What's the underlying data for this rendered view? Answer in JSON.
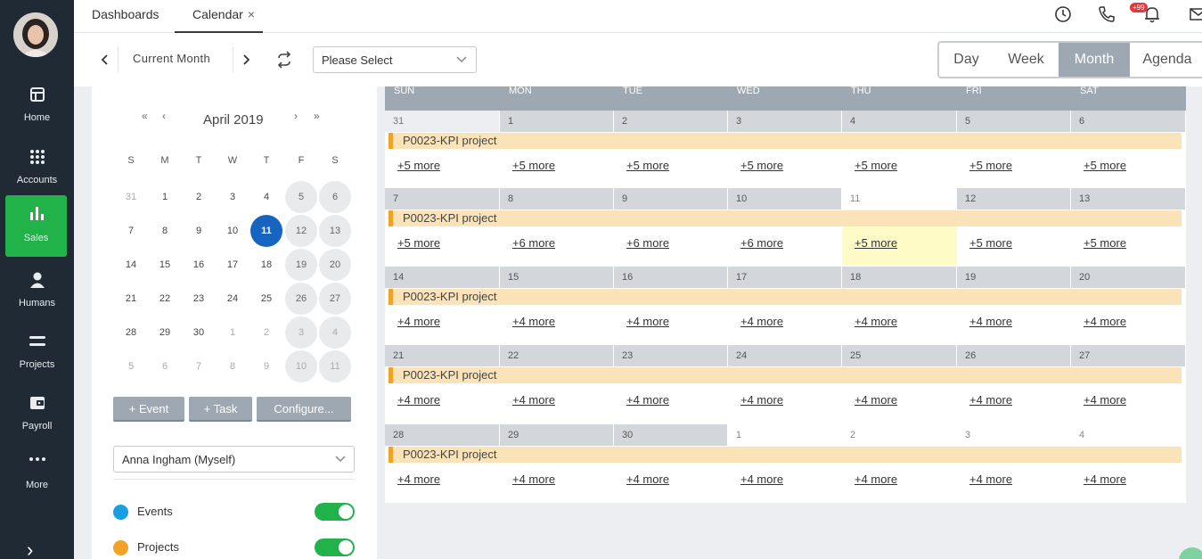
{
  "sidebar": {
    "items": [
      {
        "label": "Home",
        "icon": "home-icon"
      },
      {
        "label": "Accounts",
        "icon": "grid-icon"
      },
      {
        "label": "Sales",
        "icon": "bar-chart-icon"
      },
      {
        "label": "Humans",
        "icon": "person-icon"
      },
      {
        "label": "Projects",
        "icon": "list-icon"
      },
      {
        "label": "Payroll",
        "icon": "wallet-icon"
      },
      {
        "label": "More",
        "icon": "dots-icon"
      }
    ],
    "active_item": "Sales",
    "expand_glyph": "›"
  },
  "tabs": {
    "dashboards": "Dashboards",
    "calendar": "Calendar",
    "close_glyph": "×"
  },
  "notifications": {
    "badge": "+99"
  },
  "toolbar": {
    "current_month": "Current Month",
    "prev_glyph": "‹",
    "next_glyph": "›",
    "select_placeholder": "Please Select",
    "views": [
      "Day",
      "Week",
      "Month",
      "Agenda"
    ],
    "active_view": "Month"
  },
  "mini_calendar": {
    "title": "April 2019",
    "prev_year": "«",
    "prev_month": "‹",
    "next_month": "›",
    "next_year": "»",
    "weekday_labels": [
      "S",
      "M",
      "T",
      "W",
      "T",
      "F",
      "S"
    ],
    "weeks": [
      [
        "31",
        "1",
        "2",
        "3",
        "4",
        "5",
        "6"
      ],
      [
        "7",
        "8",
        "9",
        "10",
        "11",
        "12",
        "13"
      ],
      [
        "14",
        "15",
        "16",
        "17",
        "18",
        "19",
        "20"
      ],
      [
        "21",
        "22",
        "23",
        "24",
        "25",
        "26",
        "27"
      ],
      [
        "28",
        "29",
        "30",
        "1",
        "2",
        "3",
        "4"
      ],
      [
        "5",
        "6",
        "7",
        "8",
        "9",
        "10",
        "11"
      ]
    ],
    "today": "11"
  },
  "actions": {
    "add_event": "+ Event",
    "add_task": "+ Task",
    "configure": "Configure..."
  },
  "user_select": {
    "value": "Anna Ingham (Myself)"
  },
  "legend": [
    {
      "label": "Events",
      "color": "#1a9ee2",
      "enabled": true
    },
    {
      "label": "Projects",
      "color": "#f0a229",
      "enabled": true
    }
  ],
  "calendar": {
    "weekday_headers": [
      "SUN",
      "MON",
      "TUE",
      "WED",
      "THU",
      "FRI",
      "SAT"
    ],
    "weeks": [
      {
        "days": [
          "31",
          "1",
          "2",
          "3",
          "4",
          "5",
          "6"
        ],
        "more": [
          "+5 more",
          "+5 more",
          "+5 more",
          "+5 more",
          "+5 more",
          "+5 more",
          "+5 more"
        ]
      },
      {
        "days": [
          "7",
          "8",
          "9",
          "10",
          "11",
          "12",
          "13"
        ],
        "more": [
          "+5 more",
          "+6 more",
          "+6 more",
          "+6 more",
          "+5 more",
          "+5 more",
          "+5 more"
        ]
      },
      {
        "days": [
          "14",
          "15",
          "16",
          "17",
          "18",
          "19",
          "20"
        ],
        "more": [
          "+4 more",
          "+4 more",
          "+4 more",
          "+4 more",
          "+4 more",
          "+4 more",
          "+4 more"
        ]
      },
      {
        "days": [
          "21",
          "22",
          "23",
          "24",
          "25",
          "26",
          "27"
        ],
        "more": [
          "+4 more",
          "+4 more",
          "+4 more",
          "+4 more",
          "+4 more",
          "+4 more",
          "+4 more"
        ]
      },
      {
        "days": [
          "28",
          "29",
          "30",
          "1",
          "2",
          "3",
          "4"
        ],
        "more": [
          "+4 more",
          "+4 more",
          "+4 more",
          "+4 more",
          "+4 more",
          "+4 more",
          "+4 more"
        ]
      }
    ],
    "event_label": "P0023-KPI project",
    "event_color": "#f0a229",
    "today": "11"
  }
}
